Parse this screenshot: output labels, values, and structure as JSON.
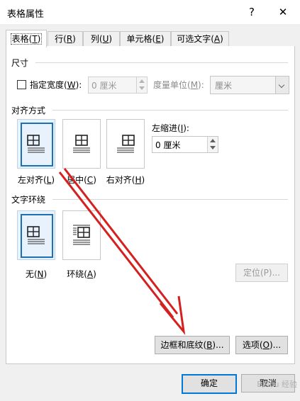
{
  "window": {
    "title": "表格属性",
    "help_glyph": "?",
    "close_glyph": "✕"
  },
  "tabs": [
    {
      "label": "表格(T)",
      "active": true
    },
    {
      "label": "行(R)",
      "active": false
    },
    {
      "label": "列(U)",
      "active": false
    },
    {
      "label": "单元格(E)",
      "active": false
    },
    {
      "label": "可选文字(A)",
      "active": false
    }
  ],
  "size": {
    "section_label": "尺寸",
    "preferred_width_label": "指定宽度(W):",
    "preferred_width_checked": false,
    "width_value": "0 厘米",
    "measure_label": "度量单位(M):",
    "measure_value": "厘米"
  },
  "alignment": {
    "section_label": "对齐方式",
    "options": [
      {
        "label": "左对齐(L)",
        "selected": true
      },
      {
        "label": "居中(C)",
        "selected": false
      },
      {
        "label": "右对齐(H)",
        "selected": false
      }
    ],
    "indent_label": "左缩进(I):",
    "indent_value": "0 厘米"
  },
  "wrapping": {
    "section_label": "文字环绕",
    "options": [
      {
        "label": "无(N)",
        "selected": true
      },
      {
        "label": "环绕(A)",
        "selected": false
      }
    ],
    "position_button": "定位(P)..."
  },
  "buttons": {
    "borders": "边框和底纹(B)...",
    "options": "选项(O)...",
    "ok": "确定",
    "cancel": "取消"
  },
  "annotation": {
    "color": "#d62020"
  },
  "watermark": {
    "text": "Baidu 经验"
  }
}
